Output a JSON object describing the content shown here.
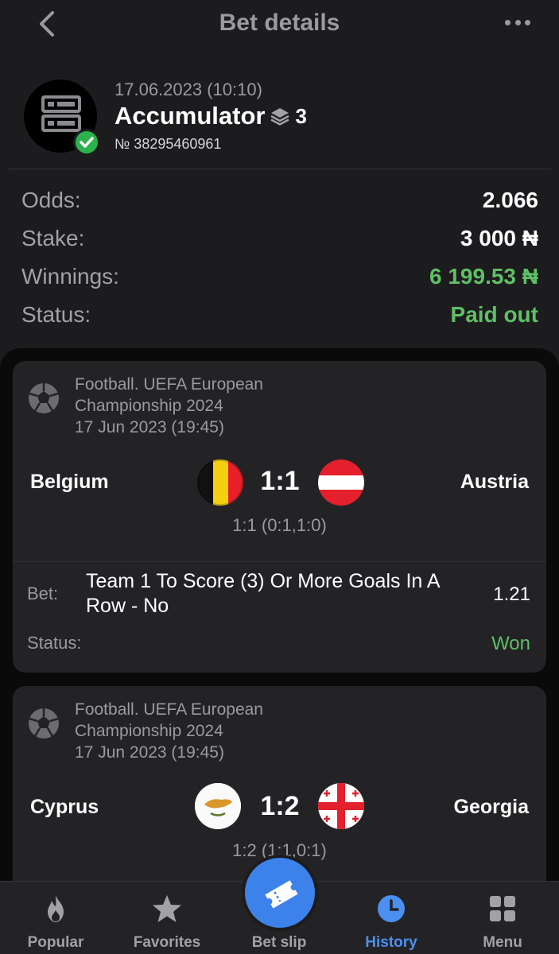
{
  "header": {
    "title": "Bet details"
  },
  "bet": {
    "date": "17.06.2023 (10:10)",
    "type": "Accumulator",
    "selections_count": "3",
    "number": "№ 38295460961"
  },
  "summary": {
    "odds_label": "Odds:",
    "odds_value": "2.066",
    "stake_label": "Stake:",
    "stake_value": "3 000 ₦",
    "winnings_label": "Winnings:",
    "winnings_value": "6 199.53 ₦",
    "status_label": "Status:",
    "status_value": "Paid out"
  },
  "events": [
    {
      "league": [
        "Football. UEFA European",
        "Championship 2024"
      ],
      "date": "17 Jun 2023 (19:45)",
      "team1": "Belgium",
      "team2": "Austria",
      "score": "1:1",
      "subscore": "1:1 (0:1,1:0)",
      "bet_label": "Bet:",
      "bet_text": "Team 1 To Score (3) Or More Goals In A Row - No",
      "bet_odd": "1.21",
      "status_label": "Status:",
      "status_value": "Won"
    },
    {
      "league": [
        "Football. UEFA European",
        "Championship 2024"
      ],
      "date": "17 Jun 2023 (19:45)",
      "team1": "Cyprus",
      "team2": "Georgia",
      "score": "1:2",
      "subscore": "1:2 (1:1,0:1)"
    }
  ],
  "nav": {
    "items": [
      {
        "label": "Popular",
        "icon": "flame-icon"
      },
      {
        "label": "Favorites",
        "icon": "star-icon"
      },
      {
        "label": "Bet slip",
        "icon": "ticket-icon"
      },
      {
        "label": "History",
        "icon": "clock-icon",
        "active": true
      },
      {
        "label": "Menu",
        "icon": "grid-icon"
      }
    ]
  },
  "colors": {
    "background": "#1c1c1e",
    "card": "#232325",
    "accent": "#3d82eb",
    "success": "#5fbf65"
  }
}
